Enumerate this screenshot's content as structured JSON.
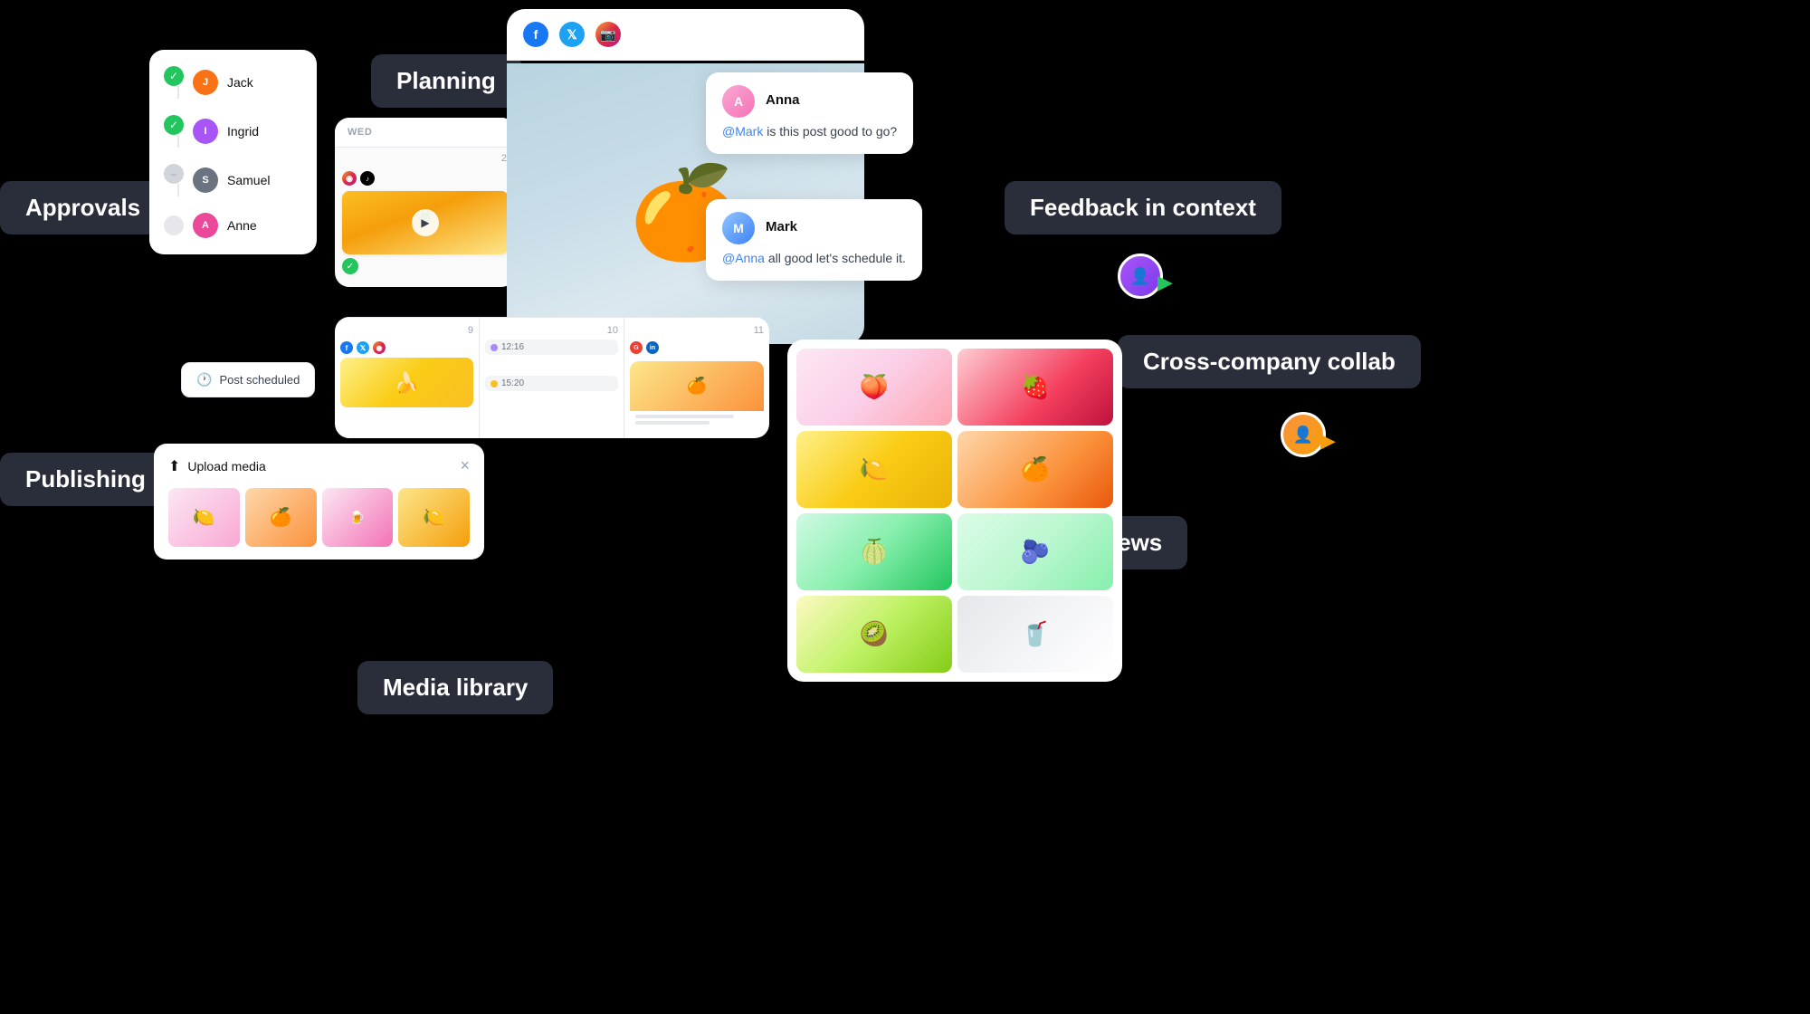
{
  "badges": {
    "planning": "Planning",
    "approvals": "Approvals",
    "publishing": "Publishing",
    "feedback": "Feedback in context",
    "crossCompany": "Cross-company collab",
    "multipleViews": "Multiple views",
    "mediaLibrary": "Media library"
  },
  "approvals": {
    "items": [
      {
        "name": "Jack",
        "status": "approved",
        "avatar": "J"
      },
      {
        "name": "Ingrid",
        "status": "approved",
        "avatar": "I"
      },
      {
        "name": "Samuel",
        "status": "pending",
        "avatar": "S"
      },
      {
        "name": "Anne",
        "status": "inactive",
        "avatar": "A"
      }
    ]
  },
  "postScheduled": "Post scheduled",
  "calendar": {
    "days": [
      "WED",
      "9",
      "10",
      "11"
    ],
    "timeSlot1": "12:16",
    "timeSlot2": "15:20"
  },
  "feedback": {
    "anna": {
      "name": "Anna",
      "mention": "@Mark",
      "text": "is this post good to go?"
    },
    "mark": {
      "name": "Mark",
      "mention": "@Anna",
      "text": "all good let's schedule it."
    }
  },
  "mediaLibrary": {
    "title": "Upload media",
    "closeLabel": "×"
  },
  "socialIcons": {
    "facebook": "f",
    "twitter": "t",
    "instagram": "◉",
    "tiktok": "♪",
    "google": "G",
    "linkedin": "in"
  }
}
